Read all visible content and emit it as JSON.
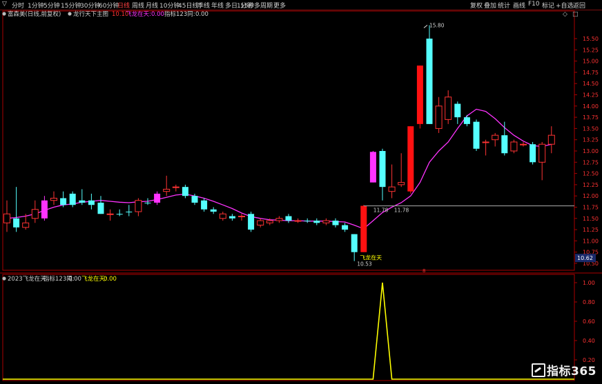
{
  "toolbar": {
    "dropdown_glyph": "▽",
    "tabs": [
      "分时",
      "1分钟",
      "5分钟",
      "15分钟",
      "30分钟",
      "60分钟",
      "日线",
      "周线",
      "月线",
      "10分钟",
      "45日线",
      "季线",
      "年线",
      "多日",
      "1分钟",
      "15秒",
      "多周期",
      "更多"
    ],
    "active_tab_index": 6,
    "right_buttons": [
      "复权",
      "叠加",
      "统计",
      "画线",
      "F10",
      "标记",
      "+自选",
      "返回"
    ],
    "window_icons": [
      "◇",
      "□"
    ]
  },
  "main_panel": {
    "header": {
      "stock_name": "富森美(日线,前复权)",
      "indicator_name": "龙行天下主图",
      "value_label": "10.10",
      "signal_label": "飞龙在天:",
      "signal_value": "0.00",
      "ref_label": "指标123同:",
      "ref_value": "0.00"
    },
    "price_axis_labels": [
      "15.50",
      "15.25",
      "15.00",
      "14.75",
      "14.50",
      "14.25",
      "14.00",
      "13.75",
      "13.50",
      "13.25",
      "13.00",
      "12.75",
      "12.50",
      "12.25",
      "12.00",
      "11.75",
      "11.50",
      "11.25",
      "11.00",
      "10.75",
      "10.50"
    ],
    "current_price_tag": "10.62",
    "annotations": {
      "high_label": "15.80",
      "low_label": "10.53",
      "resistance_label": "11.78",
      "resistance_label_2": "11.78",
      "signal_text": "飞龙在天",
      "marker_text": "8"
    }
  },
  "sub_panel": {
    "header": {
      "name": "2023飞龙在天",
      "ref_label": "指标123同:",
      "ref_value": "0.00",
      "signal_label": "飞龙在天:",
      "signal_value": "0.00"
    },
    "axis_labels": [
      "1.00",
      "0.80",
      "0.60",
      "0.40",
      "0.20"
    ]
  },
  "watermark": {
    "text": "指标365"
  },
  "colors": {
    "up": "#ff3333",
    "up_bright": "#ff1111",
    "down": "#55ffff",
    "magenta": "#ff33ff",
    "ma": "#ff33ff",
    "signal_line": "#ffff00",
    "axis": "#aa0000",
    "background": "#000000"
  },
  "chart_data": [
    {
      "type": "candlestick",
      "title": "",
      "y_range": [
        10.5,
        15.6
      ],
      "candles": [
        {
          "o": 11.4,
          "c": 11.6,
          "h": 11.9,
          "l": 11.2,
          "kind": "up"
        },
        {
          "o": 11.5,
          "c": 11.3,
          "h": 12.2,
          "l": 11.2,
          "kind": "down"
        },
        {
          "o": 11.3,
          "c": 11.4,
          "h": 11.6,
          "l": 11.25,
          "kind": "up"
        },
        {
          "o": 11.5,
          "c": 11.7,
          "h": 11.9,
          "l": 11.4,
          "kind": "up"
        },
        {
          "o": 11.5,
          "c": 11.9,
          "h": 12.0,
          "l": 11.45,
          "kind": "magenta"
        },
        {
          "o": 11.9,
          "c": 11.95,
          "h": 12.1,
          "l": 11.8,
          "kind": "up"
        },
        {
          "o": 11.95,
          "c": 11.8,
          "h": 12.1,
          "l": 11.75,
          "kind": "down"
        },
        {
          "o": 12.05,
          "c": 11.8,
          "h": 12.1,
          "l": 11.75,
          "kind": "down"
        },
        {
          "o": 11.9,
          "c": 11.85,
          "h": 12.15,
          "l": 11.8,
          "kind": "down"
        },
        {
          "o": 11.9,
          "c": 11.8,
          "h": 12.05,
          "l": 11.7,
          "kind": "down"
        },
        {
          "o": 11.85,
          "c": 11.6,
          "h": 12.0,
          "l": 11.6,
          "kind": "down"
        },
        {
          "o": 11.6,
          "c": 11.6,
          "h": 11.7,
          "l": 11.45,
          "kind": "up"
        },
        {
          "o": 11.6,
          "c": 11.6,
          "h": 11.7,
          "l": 11.55,
          "kind": "down"
        },
        {
          "o": 11.65,
          "c": 11.65,
          "h": 11.8,
          "l": 11.55,
          "kind": "down"
        },
        {
          "o": 11.65,
          "c": 11.9,
          "h": 11.95,
          "l": 11.55,
          "kind": "up"
        },
        {
          "o": 11.85,
          "c": 11.85,
          "h": 11.95,
          "l": 11.8,
          "kind": "down"
        },
        {
          "o": 11.85,
          "c": 12.05,
          "h": 12.1,
          "l": 11.8,
          "kind": "magenta"
        },
        {
          "o": 12.1,
          "c": 12.15,
          "h": 12.45,
          "l": 12.0,
          "kind": "up"
        },
        {
          "o": 12.2,
          "c": 12.2,
          "h": 12.25,
          "l": 12.1,
          "kind": "up"
        },
        {
          "o": 12.2,
          "c": 12.0,
          "h": 12.25,
          "l": 11.95,
          "kind": "down"
        },
        {
          "o": 12.0,
          "c": 11.85,
          "h": 12.05,
          "l": 11.8,
          "kind": "down"
        },
        {
          "o": 11.9,
          "c": 11.7,
          "h": 11.95,
          "l": 11.65,
          "kind": "down"
        },
        {
          "o": 11.7,
          "c": 11.65,
          "h": 11.75,
          "l": 11.6,
          "kind": "down"
        },
        {
          "o": 11.6,
          "c": 11.5,
          "h": 11.65,
          "l": 11.45,
          "kind": "up"
        },
        {
          "o": 11.55,
          "c": 11.5,
          "h": 11.6,
          "l": 11.45,
          "kind": "down"
        },
        {
          "o": 11.55,
          "c": 11.55,
          "h": 11.6,
          "l": 11.45,
          "kind": "up"
        },
        {
          "o": 11.6,
          "c": 11.25,
          "h": 11.65,
          "l": 11.2,
          "kind": "down"
        },
        {
          "o": 11.35,
          "c": 11.45,
          "h": 11.5,
          "l": 11.3,
          "kind": "up"
        },
        {
          "o": 11.4,
          "c": 11.45,
          "h": 11.5,
          "l": 11.35,
          "kind": "up"
        },
        {
          "o": 11.45,
          "c": 11.5,
          "h": 11.55,
          "l": 11.4,
          "kind": "up"
        },
        {
          "o": 11.55,
          "c": 11.45,
          "h": 11.6,
          "l": 11.4,
          "kind": "down"
        },
        {
          "o": 11.45,
          "c": 11.45,
          "h": 11.5,
          "l": 11.4,
          "kind": "up"
        },
        {
          "o": 11.45,
          "c": 11.45,
          "h": 11.5,
          "l": 11.4,
          "kind": "down"
        },
        {
          "o": 11.45,
          "c": 11.4,
          "h": 11.5,
          "l": 11.35,
          "kind": "down"
        },
        {
          "o": 11.4,
          "c": 11.45,
          "h": 11.5,
          "l": 11.35,
          "kind": "up"
        },
        {
          "o": 11.45,
          "c": 11.35,
          "h": 11.5,
          "l": 11.3,
          "kind": "down"
        },
        {
          "o": 11.35,
          "c": 11.25,
          "h": 11.4,
          "l": 11.2,
          "kind": "down"
        },
        {
          "o": 11.15,
          "c": 10.75,
          "h": 11.15,
          "l": 10.55,
          "kind": "down"
        },
        {
          "o": 10.75,
          "c": 11.78,
          "h": 11.8,
          "l": 10.75,
          "kind": "up_big"
        },
        {
          "o": 12.3,
          "c": 12.98,
          "h": 13.0,
          "l": 12.3,
          "kind": "magenta"
        },
        {
          "o": 13.0,
          "c": 12.2,
          "h": 13.05,
          "l": 11.9,
          "kind": "down"
        },
        {
          "o": 12.1,
          "c": 12.2,
          "h": 12.7,
          "l": 11.95,
          "kind": "up"
        },
        {
          "o": 12.25,
          "c": 12.3,
          "h": 12.95,
          "l": 12.2,
          "kind": "up"
        },
        {
          "o": 12.1,
          "c": 13.55,
          "h": 13.55,
          "l": 12.05,
          "kind": "up_big"
        },
        {
          "o": 13.6,
          "c": 14.9,
          "h": 14.9,
          "l": 13.5,
          "kind": "up_big"
        },
        {
          "o": 13.6,
          "c": 15.5,
          "h": 15.8,
          "l": 13.6,
          "kind": "down"
        },
        {
          "o": 13.5,
          "c": 14.0,
          "h": 14.2,
          "l": 13.4,
          "kind": "up"
        },
        {
          "o": 13.7,
          "c": 14.2,
          "h": 14.35,
          "l": 13.6,
          "kind": "up"
        },
        {
          "o": 14.05,
          "c": 13.75,
          "h": 14.1,
          "l": 13.6,
          "kind": "down"
        },
        {
          "o": 13.75,
          "c": 13.6,
          "h": 13.8,
          "l": 13.55,
          "kind": "down"
        },
        {
          "o": 13.65,
          "c": 13.05,
          "h": 13.7,
          "l": 13.0,
          "kind": "down"
        },
        {
          "o": 13.2,
          "c": 13.2,
          "h": 13.25,
          "l": 12.9,
          "kind": "up"
        },
        {
          "o": 13.25,
          "c": 13.35,
          "h": 13.4,
          "l": 13.1,
          "kind": "up"
        },
        {
          "o": 13.35,
          "c": 12.95,
          "h": 13.65,
          "l": 12.9,
          "kind": "down"
        },
        {
          "o": 13.0,
          "c": 13.2,
          "h": 13.25,
          "l": 12.95,
          "kind": "up"
        },
        {
          "o": 13.15,
          "c": 13.15,
          "h": 13.2,
          "l": 13.1,
          "kind": "up"
        },
        {
          "o": 13.15,
          "c": 12.75,
          "h": 13.2,
          "l": 12.7,
          "kind": "down"
        },
        {
          "o": 12.75,
          "c": 13.15,
          "h": 13.2,
          "l": 12.35,
          "kind": "up"
        },
        {
          "o": 13.15,
          "c": 13.35,
          "h": 13.55,
          "l": 12.95,
          "kind": "up"
        }
      ],
      "ma_line": [
        11.5,
        11.52,
        11.55,
        11.6,
        11.68,
        11.75,
        11.8,
        11.82,
        11.86,
        11.88,
        11.9,
        11.88,
        11.86,
        11.85,
        11.87,
        11.88,
        11.92,
        11.97,
        12.02,
        12.04,
        12.0,
        11.95,
        11.88,
        11.8,
        11.72,
        11.62,
        11.54,
        11.5,
        11.47,
        11.46,
        11.45,
        11.45,
        11.44,
        11.44,
        11.44,
        11.43,
        11.42,
        11.35,
        11.27,
        11.45,
        11.63,
        11.75,
        11.85,
        12.0,
        12.3,
        12.75,
        13.0,
        13.2,
        13.5,
        13.78,
        13.93,
        13.88,
        13.72,
        13.52,
        13.35,
        13.22,
        13.12,
        13.1,
        13.15
      ],
      "resistance_level": 11.78
    },
    {
      "type": "line",
      "title": "",
      "y_range": [
        0,
        1.0
      ],
      "values": [
        0,
        0,
        0,
        0,
        0,
        0,
        0,
        0,
        0,
        0,
        0,
        0,
        0,
        0,
        0,
        0,
        0,
        0,
        0,
        0,
        0,
        0,
        0,
        0,
        0,
        0,
        0,
        0,
        0,
        0,
        0,
        0,
        0,
        0,
        0,
        0,
        0,
        0,
        0,
        0,
        1,
        0,
        0,
        0,
        0,
        0,
        0,
        0,
        0,
        0,
        0,
        0,
        0,
        0,
        0,
        0,
        0,
        0,
        0
      ]
    }
  ]
}
